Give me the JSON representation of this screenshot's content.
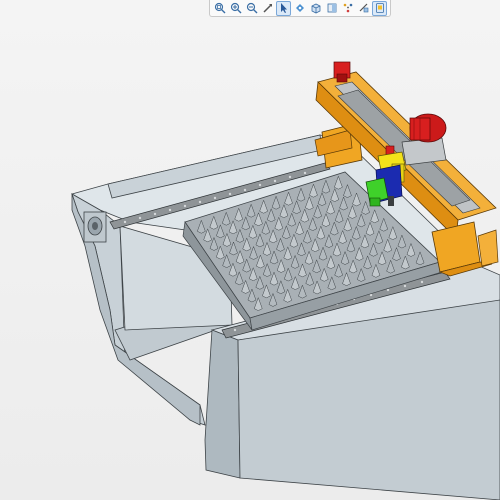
{
  "toolbar": {
    "tools": [
      {
        "name": "zoom-to-fit-icon",
        "active": false
      },
      {
        "name": "zoom-in-icon",
        "active": false
      },
      {
        "name": "zoom-out-icon",
        "active": false
      },
      {
        "name": "pan-icon",
        "active": false
      },
      {
        "name": "select-icon",
        "active": true
      },
      {
        "name": "rotate-icon",
        "active": false
      },
      {
        "name": "view-cube-icon",
        "active": false
      },
      {
        "name": "section-view-icon",
        "active": false
      },
      {
        "name": "explode-icon",
        "active": false
      },
      {
        "name": "measure-icon",
        "active": false
      },
      {
        "name": "settings-icon",
        "active": false
      }
    ]
  },
  "model": {
    "description_colors": {
      "frame": "#c9d2d8",
      "frame_dark": "#9aa6ae",
      "rail": "#8b8f92",
      "gantry": "#f0a623",
      "motor": "#d81f1f",
      "spindle_block": "#f3e21a",
      "spindle_body": "#1b2bb0",
      "tool_head": "#3fd12a",
      "fixture": "#aeb4b8"
    }
  }
}
